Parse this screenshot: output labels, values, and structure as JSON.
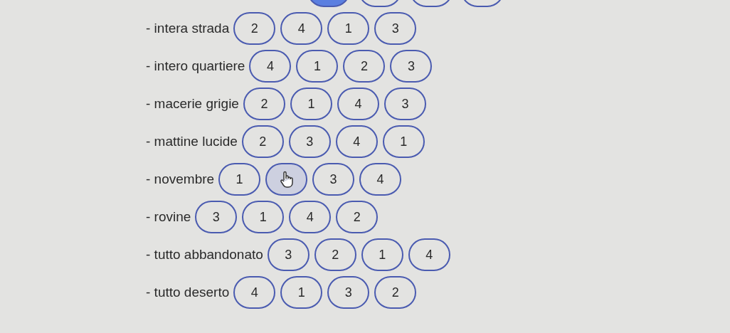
{
  "partial_row": [
    {
      "selected": true
    },
    {
      "selected": false
    },
    {
      "selected": false
    },
    {
      "selected": false
    }
  ],
  "rows": [
    {
      "label": "- intera strada",
      "options": [
        {
          "label": "2",
          "hovered": false
        },
        {
          "label": "4",
          "hovered": false
        },
        {
          "label": "1",
          "hovered": false
        },
        {
          "label": "3",
          "hovered": false
        }
      ]
    },
    {
      "label": "- intero quartiere",
      "options": [
        {
          "label": "4",
          "hovered": false
        },
        {
          "label": "1",
          "hovered": false
        },
        {
          "label": "2",
          "hovered": false
        },
        {
          "label": "3",
          "hovered": false
        }
      ]
    },
    {
      "label": "- macerie grigie",
      "options": [
        {
          "label": "2",
          "hovered": false
        },
        {
          "label": "1",
          "hovered": false
        },
        {
          "label": "4",
          "hovered": false
        },
        {
          "label": "3",
          "hovered": false
        }
      ]
    },
    {
      "label": "- mattine lucide",
      "options": [
        {
          "label": "2",
          "hovered": false
        },
        {
          "label": "3",
          "hovered": false
        },
        {
          "label": "4",
          "hovered": false
        },
        {
          "label": "1",
          "hovered": false
        }
      ]
    },
    {
      "label": "- novembre",
      "options": [
        {
          "label": "1",
          "hovered": false
        },
        {
          "hovered": true
        },
        {
          "label": "3",
          "hovered": false
        },
        {
          "label": "4",
          "hovered": false
        }
      ]
    },
    {
      "label": "- rovine",
      "options": [
        {
          "label": "3",
          "hovered": false
        },
        {
          "label": "1",
          "hovered": false
        },
        {
          "label": "4",
          "hovered": false
        },
        {
          "label": "2",
          "hovered": false
        }
      ]
    },
    {
      "label": "- tutto abbandonato",
      "options": [
        {
          "label": "3",
          "hovered": false
        },
        {
          "label": "2",
          "hovered": false
        },
        {
          "label": "1",
          "hovered": false
        },
        {
          "label": "4",
          "hovered": false
        }
      ]
    },
    {
      "label": "- tutto deserto",
      "options": [
        {
          "label": "4",
          "hovered": false
        },
        {
          "label": "1",
          "hovered": false
        },
        {
          "label": "3",
          "hovered": false
        },
        {
          "label": "2",
          "hovered": false
        }
      ]
    }
  ]
}
